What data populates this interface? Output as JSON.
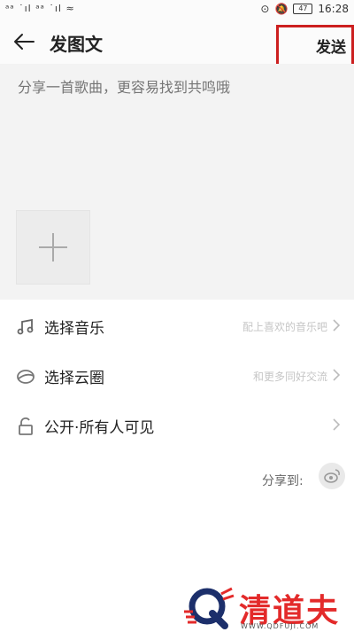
{
  "status_bar": {
    "left_text": "ᵃᵃ ˙ıl ᵃᵃ ˙ıl ≈",
    "time": "16:28",
    "battery": "47"
  },
  "header": {
    "title": "发图文",
    "send_label": "发送"
  },
  "editor": {
    "placeholder": "分享一首歌曲，更容易找到共鸣哦"
  },
  "options": [
    {
      "icon": "music-note-icon",
      "label": "选择音乐",
      "hint": "配上喜欢的音乐吧"
    },
    {
      "icon": "cloud-circle-icon",
      "label": "选择云圈",
      "hint": "和更多同好交流"
    },
    {
      "icon": "unlock-icon",
      "label": "公开·所有人可见",
      "hint": ""
    }
  ],
  "share": {
    "label": "分享到:"
  },
  "watermark": {
    "text": "清道夫",
    "url": "WWW.QDFUJI.COM"
  }
}
